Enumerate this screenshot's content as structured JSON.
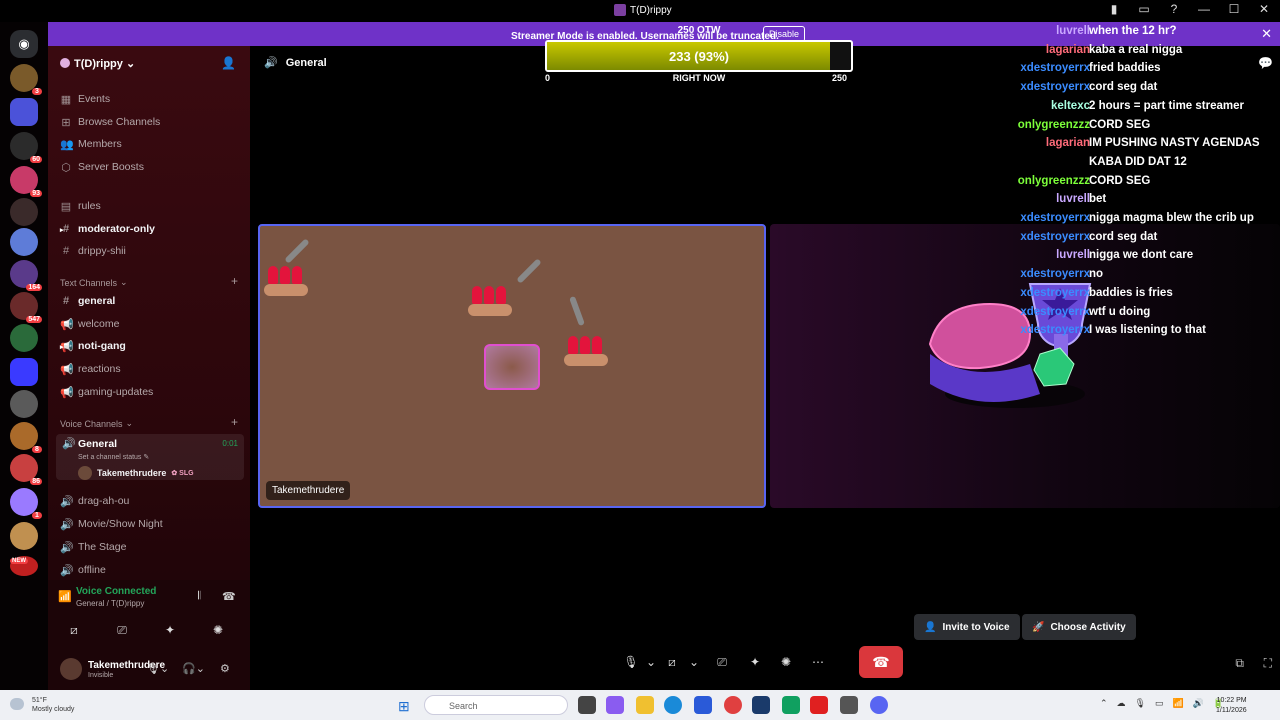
{
  "window": {
    "title": "T(D)rippy",
    "controls": [
      "▮",
      "▭",
      "?",
      "—",
      "☐",
      "✕"
    ]
  },
  "banner": {
    "message": "Streamer Mode is enabled. Usernames will be truncated.",
    "button": "Disable"
  },
  "server": {
    "name": "T(D)rippy"
  },
  "rail": {
    "badges": [
      "3",
      "60",
      "93",
      "164",
      "547",
      "8",
      "86",
      "1",
      "NEW"
    ],
    "colors": [
      "#7a5a2a",
      "#4b52d9",
      "#2b2b2b",
      "#c83a68",
      "#3a2a2a",
      "#5e7cd8",
      "#5a3a8a",
      "#6a2a2a",
      "#2a6a3a",
      "#3a3aff",
      "#5a5a5a",
      "#aa6a2a",
      "#c84040",
      "#9a7aff",
      "#c09050",
      "#c02020"
    ]
  },
  "nav": {
    "top": [
      {
        "icon": "▦",
        "label": "Events"
      },
      {
        "icon": "⊞",
        "label": "Browse Channels"
      },
      {
        "icon": "👥",
        "label": "Members"
      },
      {
        "icon": "⬡",
        "label": "Server Boosts"
      }
    ],
    "channels": [
      {
        "icon": "▤",
        "label": "rules",
        "bold": false
      },
      {
        "icon": "#",
        "label": "moderator-only",
        "bold": true
      },
      {
        "icon": "#",
        "label": "drippy-shii",
        "bold": false
      }
    ],
    "text_category": "Text Channels",
    "text_channels": [
      {
        "icon": "#",
        "label": "general",
        "bold": true
      },
      {
        "icon": "📢",
        "label": "welcome",
        "bold": false
      },
      {
        "icon": "📢",
        "label": "noti-gang",
        "bold": true
      },
      {
        "icon": "📢",
        "label": "reactions",
        "bold": false
      },
      {
        "icon": "📢",
        "label": "gaming-updates",
        "bold": false
      }
    ],
    "voice_category": "Voice Channels",
    "voice_general": {
      "label": "General",
      "time": "0:01",
      "status": "Set a channel status"
    },
    "voice_user": {
      "name": "Takemethrudere",
      "tag": "SLG"
    },
    "voice_channels": [
      {
        "icon": "🔊",
        "label": "drag-ah-ou"
      },
      {
        "icon": "🔊",
        "label": "Movie/Show Night"
      },
      {
        "icon": "🔊",
        "label": "The Stage"
      },
      {
        "icon": "🔊",
        "label": "offline"
      }
    ]
  },
  "voice_connected": {
    "title": "Voice Connected",
    "subtitle": "General / T(D)rippy"
  },
  "user": {
    "name": "Takemethrudere",
    "status": "Invisible"
  },
  "main": {
    "channel_title": "General",
    "tile_label": "Takemethrudere",
    "invite_button": "Invite to Voice",
    "activity_button": "Choose Activity"
  },
  "goal": {
    "title": "250 OTW",
    "value_text": "233 (93%)",
    "progress": 0.932,
    "min": "0",
    "now": "RIGHT NOW",
    "max": "250"
  },
  "chat": [
    {
      "user": "luvrell",
      "color": "#c9a8ff",
      "text": "when the 12 hr?"
    },
    {
      "user": "lagarian",
      "color": "#ff6b7a",
      "text": "kaba a real nigga"
    },
    {
      "user": "xdestroyerrx",
      "color": "#3b8cff",
      "text": "fried baddies"
    },
    {
      "user": "xdestroyerrx",
      "color": "#3b8cff",
      "text": "cord seg dat"
    },
    {
      "user": "keltexc",
      "color": "#a8ffe0",
      "text": "2 hours = part time streamer"
    },
    {
      "user": "onlygreenzzz",
      "color": "#7dff3a",
      "text": "CORD SEG"
    },
    {
      "user": "lagarian",
      "color": "#ff6b7a",
      "text": "IM PUSHING NASTY AGENDAS"
    },
    {
      "user": "",
      "color": "#ff6b7a",
      "text": "KABA DID DAT 12"
    },
    {
      "user": "onlygreenzzz",
      "color": "#7dff3a",
      "text": "CORD SEG"
    },
    {
      "user": "luvrell",
      "color": "#c9a8ff",
      "text": "bet"
    },
    {
      "user": "xdestroyerrx",
      "color": "#3b8cff",
      "text": "nigga magma blew the crib up"
    },
    {
      "user": "xdestroyerrx",
      "color": "#3b8cff",
      "text": "cord seg dat"
    },
    {
      "user": "luvrell",
      "color": "#c9a8ff",
      "text": "nigga we dont care"
    },
    {
      "user": "xdestroyerrx",
      "color": "#3b8cff",
      "text": "no"
    },
    {
      "user": "xdestroyerrx",
      "color": "#3b8cff",
      "text": "baddies is fries"
    },
    {
      "user": "xdestroyerrx",
      "color": "#3b8cff",
      "text": "wtf u doing"
    },
    {
      "user": "xdestroyerrx",
      "color": "#3b8cff",
      "text": "I was listening to that"
    }
  ],
  "taskbar": {
    "temp": "51°F",
    "weather": "Mostly cloudy",
    "search": "Search",
    "time": "10:22 PM",
    "date": "1/11/2026"
  }
}
